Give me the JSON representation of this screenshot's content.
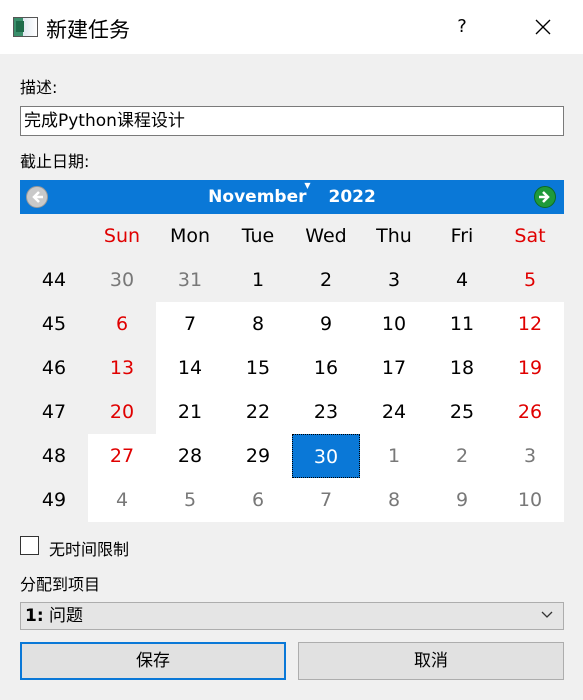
{
  "window": {
    "title": "新建任务",
    "help_label": "?"
  },
  "description": {
    "label": "描述:",
    "value": "完成Python课程设计"
  },
  "deadline": {
    "label": "截止日期:"
  },
  "calendar": {
    "month": "November",
    "year": "2022",
    "weekdays": [
      "Sun",
      "Mon",
      "Tue",
      "Wed",
      "Thu",
      "Fri",
      "Sat"
    ],
    "weeks": [
      {
        "num": "44",
        "days": [
          "30",
          "31",
          "1",
          "2",
          "3",
          "4",
          "5"
        ]
      },
      {
        "num": "45",
        "days": [
          "6",
          "7",
          "8",
          "9",
          "10",
          "11",
          "12"
        ]
      },
      {
        "num": "46",
        "days": [
          "13",
          "14",
          "15",
          "16",
          "17",
          "18",
          "19"
        ]
      },
      {
        "num": "47",
        "days": [
          "20",
          "21",
          "22",
          "23",
          "24",
          "25",
          "26"
        ]
      },
      {
        "num": "48",
        "days": [
          "27",
          "28",
          "29",
          "30",
          "1",
          "2",
          "3"
        ]
      },
      {
        "num": "49",
        "days": [
          "4",
          "5",
          "6",
          "7",
          "8",
          "9",
          "10"
        ]
      }
    ],
    "selected_day": "30",
    "colors": {
      "header": "#0a78d7",
      "weekend": "#e00000",
      "other_month": "#787878"
    }
  },
  "no_time_limit": {
    "label": "无时间限制",
    "checked": false
  },
  "project": {
    "label": "分配到项目",
    "selected_num": "1:",
    "selected_name": "问题"
  },
  "buttons": {
    "save": "保存",
    "cancel": "取消"
  }
}
